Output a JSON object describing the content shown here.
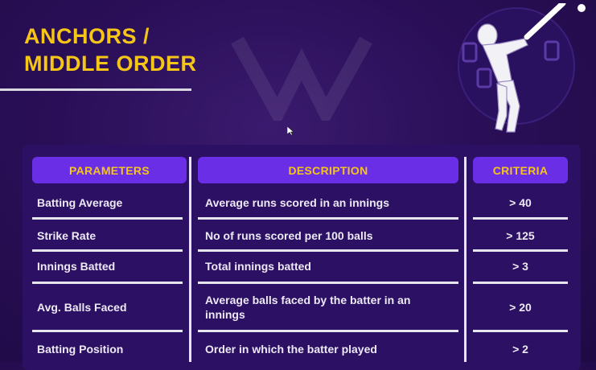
{
  "title": {
    "line1": "ANCHORS /",
    "line2": "MIDDLE ORDER"
  },
  "colors": {
    "background": "#2a0f58",
    "accent": "#f5c518",
    "header": "#6a2ee6"
  },
  "table": {
    "headers": [
      "PARAMETERS",
      "DESCRIPTION",
      "CRITERIA"
    ],
    "rows": [
      {
        "parameter": "Batting Average",
        "description": "Average runs scored in an innings",
        "criteria": "> 40"
      },
      {
        "parameter": "Strike Rate",
        "description": "No of runs scored per 100 balls",
        "criteria": "> 125"
      },
      {
        "parameter": "Innings Batted",
        "description": "Total innings batted",
        "criteria": "> 3"
      },
      {
        "parameter": "Avg. Balls Faced",
        "description": "Average balls faced by the batter in an innings",
        "criteria": "> 20"
      },
      {
        "parameter": "Batting Position",
        "description": "Order in which the batter played",
        "criteria": "> 2"
      }
    ]
  },
  "icons": {
    "illustration": "cricket-batter-icon",
    "cursor": "mouse-pointer-icon",
    "watermark": "logo-watermark-icon"
  }
}
